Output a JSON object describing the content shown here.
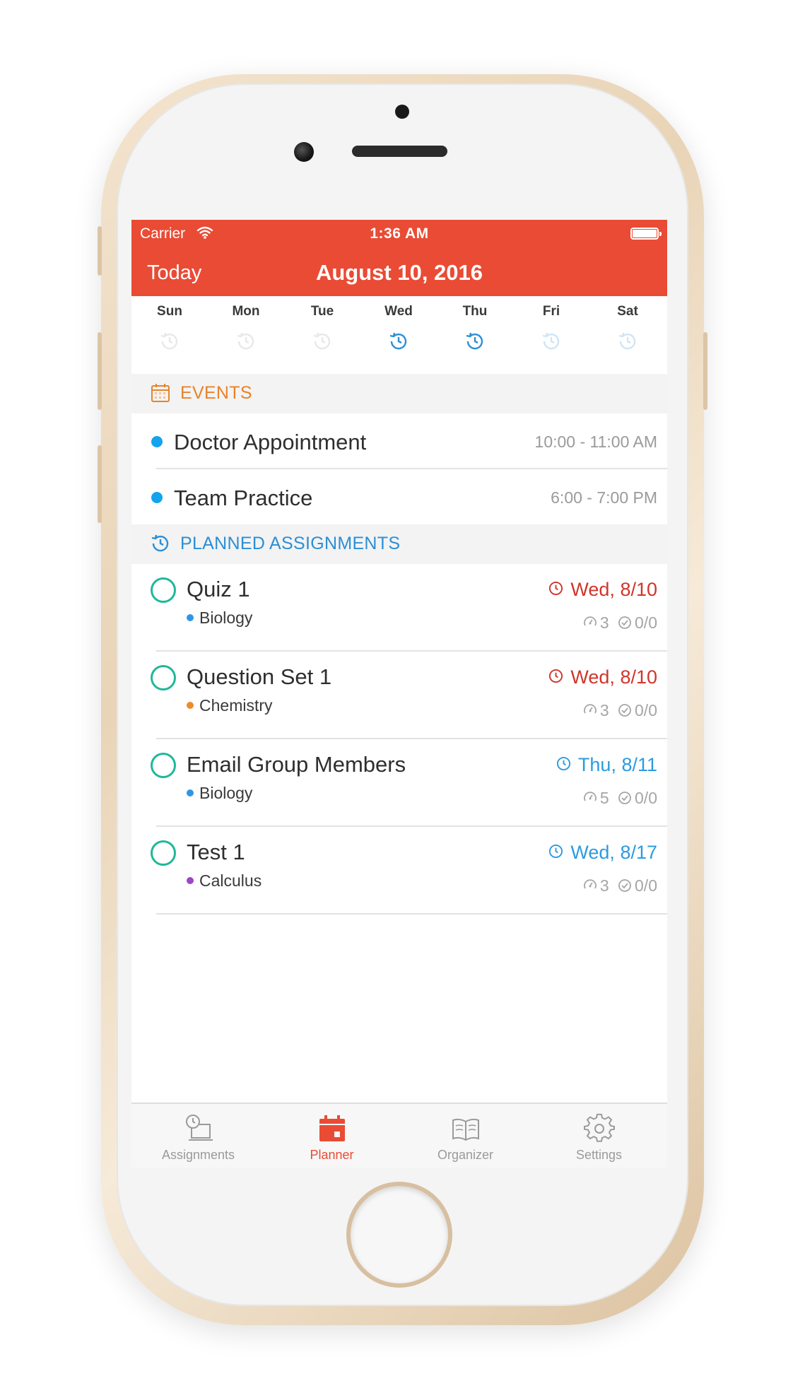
{
  "status_bar": {
    "carrier": "Carrier",
    "time": "1:36 AM"
  },
  "nav": {
    "left_button": "Today",
    "title": "August 10, 2016"
  },
  "week": [
    {
      "label": "Sun",
      "active": false
    },
    {
      "label": "Mon",
      "active": false
    },
    {
      "label": "Tue",
      "active": false
    },
    {
      "label": "Wed",
      "active": true
    },
    {
      "label": "Thu",
      "active": true
    },
    {
      "label": "Fri",
      "active": false
    },
    {
      "label": "Sat",
      "active": false
    }
  ],
  "events_section": {
    "title": "EVENTS",
    "icon": "calendar-icon"
  },
  "events": [
    {
      "title": "Doctor Appointment",
      "time": "10:00 - 11:00 AM",
      "color": "#14a3ee"
    },
    {
      "title": "Team Practice",
      "time": "6:00 - 7:00 PM",
      "color": "#14a3ee"
    }
  ],
  "assignments_section": {
    "title": "PLANNED ASSIGNMENTS",
    "icon": "history-clock-icon"
  },
  "assignments": [
    {
      "title": "Quiz 1",
      "course": "Biology",
      "course_color": "#2f96e6",
      "due": "Wed, 8/10",
      "due_color": "#d0352a",
      "time_estimate": "3",
      "progress": "0/0"
    },
    {
      "title": "Question Set 1",
      "course": "Chemistry",
      "course_color": "#ee8b2a",
      "due": "Wed, 8/10",
      "due_color": "#d0352a",
      "time_estimate": "3",
      "progress": "0/0"
    },
    {
      "title": "Email Group Members",
      "course": "Biology",
      "course_color": "#2f96e6",
      "due": "Thu, 8/11",
      "due_color": "#2b9be0",
      "time_estimate": "5",
      "progress": "0/0"
    },
    {
      "title": "Test 1",
      "course": "Calculus",
      "course_color": "#9b45c9",
      "due": "Wed, 8/17",
      "due_color": "#2b9be0",
      "time_estimate": "3",
      "progress": "0/0"
    }
  ],
  "tabs": [
    {
      "label": "Assignments",
      "icon": "assignments-icon",
      "active": false
    },
    {
      "label": "Planner",
      "icon": "planner-calendar-icon",
      "active": true
    },
    {
      "label": "Organizer",
      "icon": "book-icon",
      "active": false
    },
    {
      "label": "Settings",
      "icon": "gear-icon",
      "active": false
    }
  ],
  "colors": {
    "accent": "#e94b35",
    "events_header": "#e8832a",
    "assignments_header": "#2b8fd6",
    "check": "#1fb89a"
  }
}
